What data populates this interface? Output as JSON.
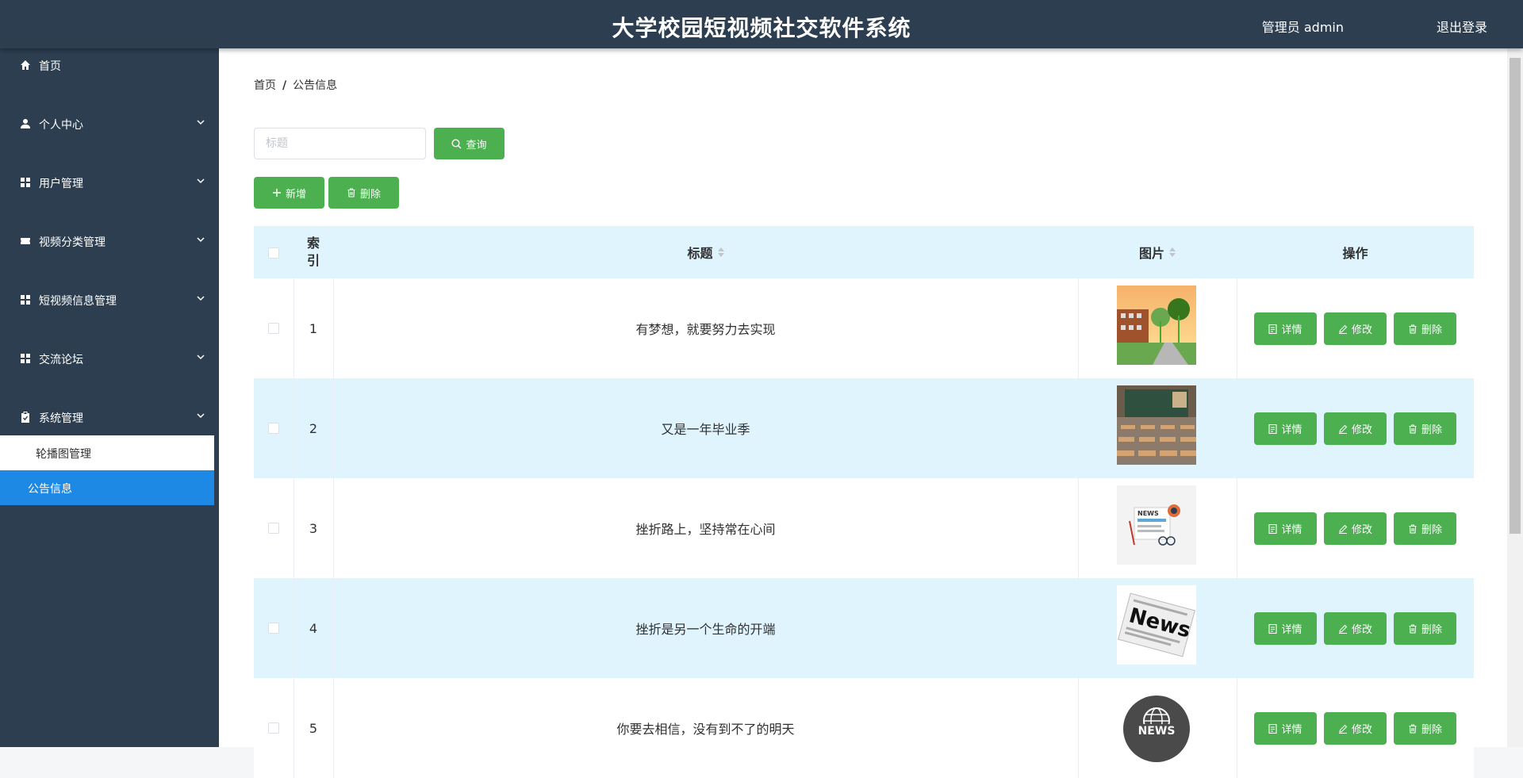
{
  "header": {
    "title": "大学校园短视频社交软件系统",
    "user_label": "管理员 admin",
    "logout_label": "退出登录"
  },
  "sidebar": {
    "items": [
      {
        "label": "首页",
        "icon": "home-icon"
      },
      {
        "label": "个人中心",
        "icon": "user-icon"
      },
      {
        "label": "用户管理",
        "icon": "grid-icon"
      },
      {
        "label": "视频分类管理",
        "icon": "ticket-icon"
      },
      {
        "label": "短视频信息管理",
        "icon": "grid-icon"
      },
      {
        "label": "交流论坛",
        "icon": "grid-icon"
      },
      {
        "label": "系统管理",
        "icon": "clipboard-icon"
      }
    ],
    "submenu": [
      {
        "label": "轮播图管理"
      },
      {
        "label": "公告信息"
      }
    ]
  },
  "breadcrumb": {
    "home": "首页",
    "sep": "/",
    "current": "公告信息"
  },
  "search": {
    "placeholder": "标题",
    "query_label": "查询"
  },
  "toolbar": {
    "add_label": "新增",
    "delete_label": "删除"
  },
  "table": {
    "columns": {
      "index": "索引",
      "title": "标题",
      "image": "图片",
      "actions": "操作"
    },
    "action_labels": {
      "detail": "详情",
      "edit": "修改",
      "delete": "删除"
    },
    "rows": [
      {
        "index": "1",
        "title": "有梦想，就要努力去实现",
        "image": "campus-photo"
      },
      {
        "index": "2",
        "title": "又是一年毕业季",
        "image": "classroom-photo"
      },
      {
        "index": "3",
        "title": "挫折路上，坚持常在心间",
        "image": "news-illustration"
      },
      {
        "index": "4",
        "title": "挫折是另一个生命的开端",
        "image": "newspaper-photo"
      },
      {
        "index": "5",
        "title": "你要去相信，没有到不了的明天",
        "image": "news-globe-icon"
      }
    ]
  },
  "colors": {
    "header_bg": "#2c3e50",
    "accent_green": "#4caf50",
    "active_blue": "#1e88e5",
    "row_alt": "#e0f4fd"
  }
}
